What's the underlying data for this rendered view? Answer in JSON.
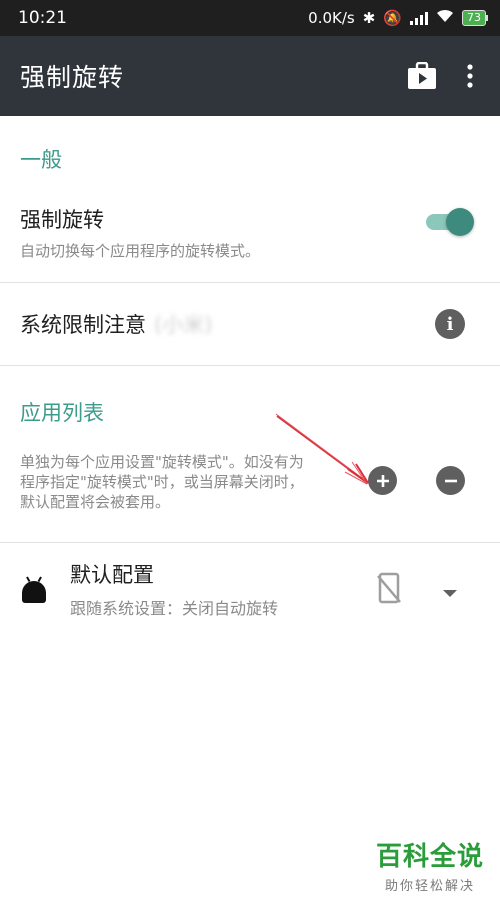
{
  "status_bar": {
    "time": "10:21",
    "net_speed": "0.0K/s",
    "battery": "73"
  },
  "toolbar": {
    "title": "强制旋转",
    "store_icon": "play-store-icon",
    "menu_icon": "more-vertical-icon"
  },
  "general": {
    "header": "一般",
    "force_rotate": {
      "title": "强制旋转",
      "summary": "自动切换每个应用程序的旋转模式。",
      "enabled": true
    },
    "system_limit": {
      "title": "系统限制注意",
      "blurred_suffix": "(小米)",
      "icon": "info-icon"
    }
  },
  "app_list": {
    "header": "应用列表",
    "description": "单独为每个应用设置\"旋转模式\"。如没有为程序指定\"旋转模式\"时，或当屏幕关闭时，默认配置将会被套用。",
    "add_icon": "plus-circle-icon",
    "remove_icon": "minus-circle-icon",
    "default_config": {
      "title": "默认配置",
      "summary": "跟随系统设置：关闭自动旋转",
      "app_icon": "android-icon",
      "rotation_icon": "screen-rotation-off-icon",
      "dropdown_icon": "triangle-down-icon"
    }
  },
  "watermark": {
    "title": "百科全说",
    "subtitle": "助你轻松解决"
  },
  "colors": {
    "accent": "#3c9b8b",
    "toolbar": "#2f353b",
    "status_bar": "#1f1f1f",
    "annotation_arrow": "#d9303a"
  }
}
